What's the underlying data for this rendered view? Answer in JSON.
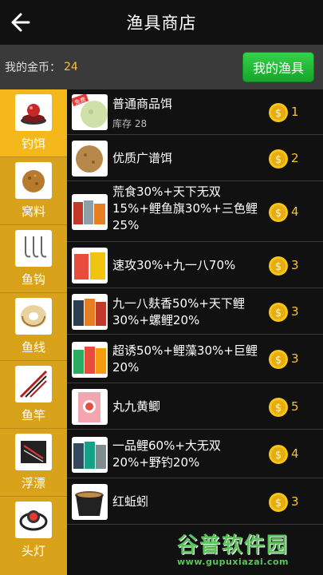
{
  "header": {
    "title": "渔具商店"
  },
  "coins": {
    "label": "我的金币：",
    "value": "24"
  },
  "my_gear_button": "我的渔具",
  "sidebar": [
    {
      "label": "钓饵",
      "icon": "bait-icon",
      "active": true
    },
    {
      "label": "窝料",
      "icon": "groundbait-ball-icon",
      "active": false
    },
    {
      "label": "鱼钩",
      "icon": "fishhook-icon",
      "active": false
    },
    {
      "label": "鱼线",
      "icon": "fishing-line-spool-icon",
      "active": false
    },
    {
      "label": "鱼竿",
      "icon": "fishing-rod-icon",
      "active": false
    },
    {
      "label": "浮漂",
      "icon": "float-icon",
      "active": false
    },
    {
      "label": "头灯",
      "icon": "headlamp-icon",
      "active": false
    }
  ],
  "products": [
    {
      "name": "普通商品饵",
      "stock_label": "库存 28",
      "price": "1",
      "badge": "免费"
    },
    {
      "name": "优质广谱饵",
      "price": "2"
    },
    {
      "name": "荒食30%+天下无双15%+鲤鱼旗30%+三色鲤25%",
      "price": "4"
    },
    {
      "name": "速攻30%+九一八70%",
      "price": "3"
    },
    {
      "name": "九一八麸香50%+天下鲤30%+螺鲤20%",
      "price": "3"
    },
    {
      "name": "超诱50%+鲤藻30%+巨鲤20%",
      "price": "3"
    },
    {
      "name": "丸九黄鲫",
      "price": "5"
    },
    {
      "name": "一品鲤60%+大无双20%+野钓20%",
      "price": "4"
    },
    {
      "name": "红蚯蚓",
      "price": "3"
    }
  ],
  "watermark": {
    "text": "谷普软件园",
    "url": "www.gupuxiazai.com"
  },
  "colors": {
    "accent_gold": "#f2c23a",
    "sidebar": "#d9a21b",
    "button_green": "#17a42a",
    "watermark_green": "#5cc25c"
  }
}
